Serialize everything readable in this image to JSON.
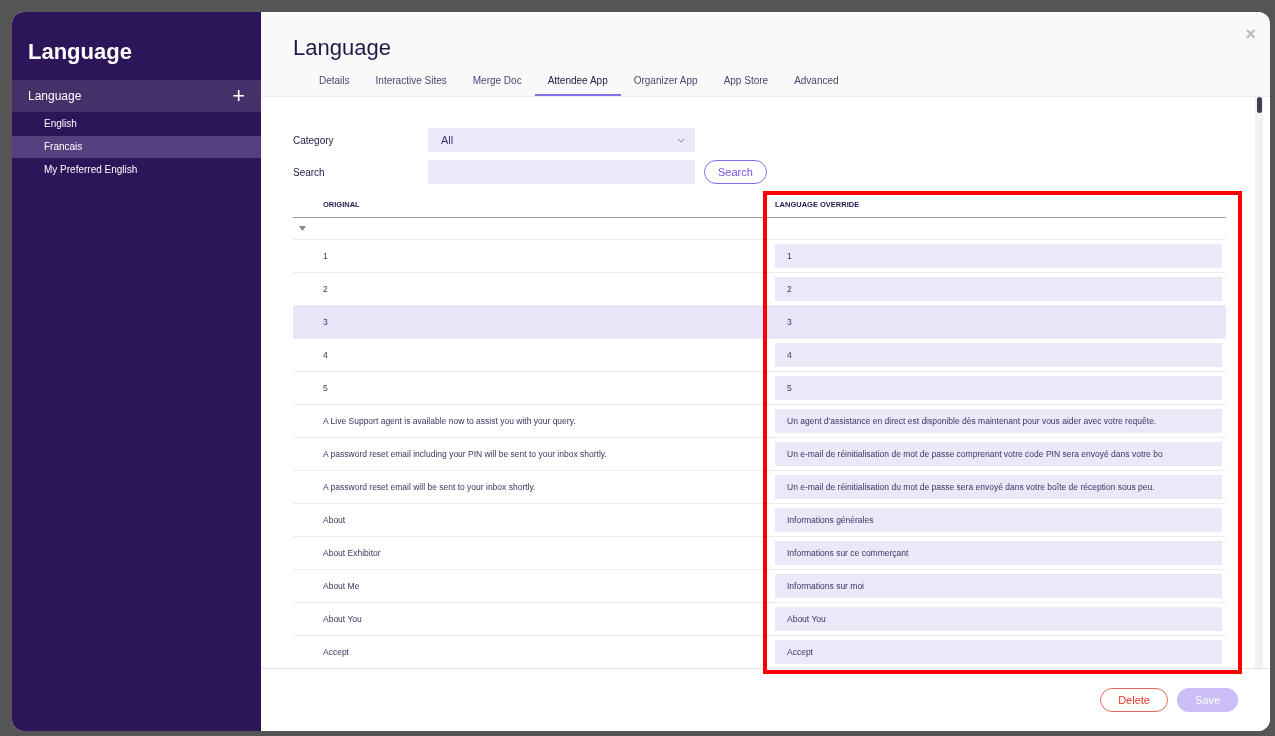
{
  "sidebar": {
    "title": "Language",
    "section": {
      "label": "Language",
      "add": "+"
    },
    "items": [
      {
        "label": "English",
        "selected": false
      },
      {
        "label": "Francais",
        "selected": true
      },
      {
        "label": "My Preferred English",
        "selected": false
      }
    ]
  },
  "header": {
    "title": "Language",
    "close": "×"
  },
  "tabs": [
    {
      "label": "Details",
      "selected": false
    },
    {
      "label": "Interactive Sites",
      "selected": false
    },
    {
      "label": "Merge Doc",
      "selected": false
    },
    {
      "label": "Attendee App",
      "selected": true
    },
    {
      "label": "Organizer App",
      "selected": false
    },
    {
      "label": "App Store",
      "selected": false
    },
    {
      "label": "Advanced",
      "selected": false
    }
  ],
  "filters": {
    "category_label": "Category",
    "category_value": "All",
    "search_label": "Search",
    "search_button": "Search"
  },
  "table": {
    "columns": [
      "ORIGINAL",
      "LANGUAGE OVERRIDE"
    ],
    "group_expanded": true,
    "rows": [
      {
        "original": "1",
        "override": "1",
        "selected": false
      },
      {
        "original": "2",
        "override": "2",
        "selected": false
      },
      {
        "original": "3",
        "override": "3",
        "selected": true
      },
      {
        "original": "4",
        "override": "4",
        "selected": false
      },
      {
        "original": "5",
        "override": "5",
        "selected": false
      },
      {
        "original": "A Live Support agent is available now to assist you with your query.",
        "override": "Un agent d'assistance en direct est disponible dès maintenant pour vous aider avec votre requête.",
        "selected": false
      },
      {
        "original": "A password reset email including your PIN will be sent to your inbox shortly.",
        "override": "Un e-mail de réinitialisation de mot de passe comprenant votre code PIN sera envoyé dans votre bo",
        "selected": false
      },
      {
        "original": "A password reset email will be sent to your inbox shortly.",
        "override": "Un e-mail de réinitialisation du mot de passe sera envoyé dans votre boîte de réception sous peu.",
        "selected": false
      },
      {
        "original": "About",
        "override": "Informations générales",
        "selected": false
      },
      {
        "original": "About Exhibitor",
        "override": "Informations sur ce commerçant",
        "selected": false
      },
      {
        "original": "About Me",
        "override": "Informations sur moi",
        "selected": false
      },
      {
        "original": "About You",
        "override": "About You",
        "selected": false
      },
      {
        "original": "Accept",
        "override": "Accept",
        "selected": false
      }
    ]
  },
  "highlight_override_column": true,
  "buttons": [
    {
      "label": "Delete",
      "kind": "danger",
      "disabled": false
    },
    {
      "label": "Save",
      "kind": "primary",
      "disabled": true
    }
  ]
}
